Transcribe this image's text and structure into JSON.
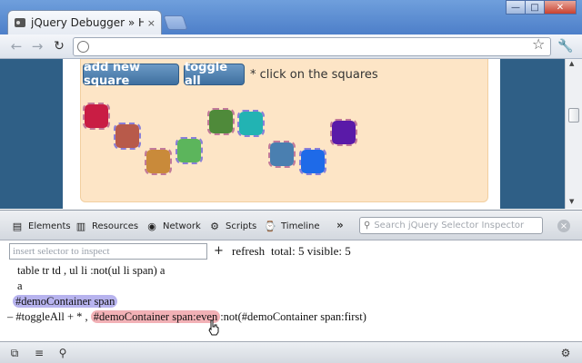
{
  "browser": {
    "tab_title": "jQuery Debugger » How T",
    "tab_close": "×",
    "window_buttons": {
      "minimize": "—",
      "maximize": "□",
      "close": "✕"
    },
    "nav": {
      "back": "←",
      "forward": "→",
      "reload": "↻",
      "star": "☆",
      "wrench": "🔧"
    }
  },
  "page": {
    "buttons": {
      "add": "add new square",
      "toggle": "toggle all"
    },
    "hint": "* click on the squares",
    "squares": [
      {
        "color": "#c91d44",
        "selected": false
      },
      {
        "color": "#b85a4a",
        "selected": true
      },
      {
        "color": "#c98a3a",
        "selected": false
      },
      {
        "color": "#5cb55c",
        "selected": true
      },
      {
        "color": "#4f8a3a",
        "selected": false
      },
      {
        "color": "#22b3b3",
        "selected": true
      },
      {
        "color": "#4a7fb0",
        "selected": false
      },
      {
        "color": "#1e6ae8",
        "selected": true
      },
      {
        "color": "#5a1aa8",
        "selected": false
      }
    ],
    "scroll": {
      "up": "▲",
      "down": "▼"
    }
  },
  "devtools": {
    "tabs": [
      {
        "label": "Elements",
        "icon": "elements-icon",
        "glyph": "▤"
      },
      {
        "label": "Resources",
        "icon": "resources-icon",
        "glyph": "▥"
      },
      {
        "label": "Network",
        "icon": "network-icon",
        "glyph": "◉"
      },
      {
        "label": "Scripts",
        "icon": "scripts-icon",
        "glyph": "⚙"
      },
      {
        "label": "Timeline",
        "icon": "timeline-icon",
        "glyph": "⌚"
      }
    ],
    "more": "»",
    "search_placeholder": "Search jQuery Selector Inspector",
    "close": "×"
  },
  "inspector": {
    "input_placeholder": "insert selector to inspect",
    "plus": "+",
    "refresh": "refresh",
    "total": "total: 5 visible: 5",
    "selectors": {
      "line1": "table tr td , ul li :not(ul li span) a",
      "line2": "a",
      "line3": "#demoContainer span",
      "line4_prefix": "– #toggleAll + * ,",
      "line4_hl": "#demoContainer span:even",
      "line4_suffix": ":not(#demoContainer span:first)"
    }
  },
  "statusbar": {
    "dock": "⧉",
    "console": "≡",
    "search": "⚲",
    "settings": "⚙"
  },
  "colors": {
    "accent": "#3e6f9f",
    "panel": "#fde5c6",
    "highlight_blue": "#b7b3ee",
    "highlight_red": "#f2b1b6"
  }
}
